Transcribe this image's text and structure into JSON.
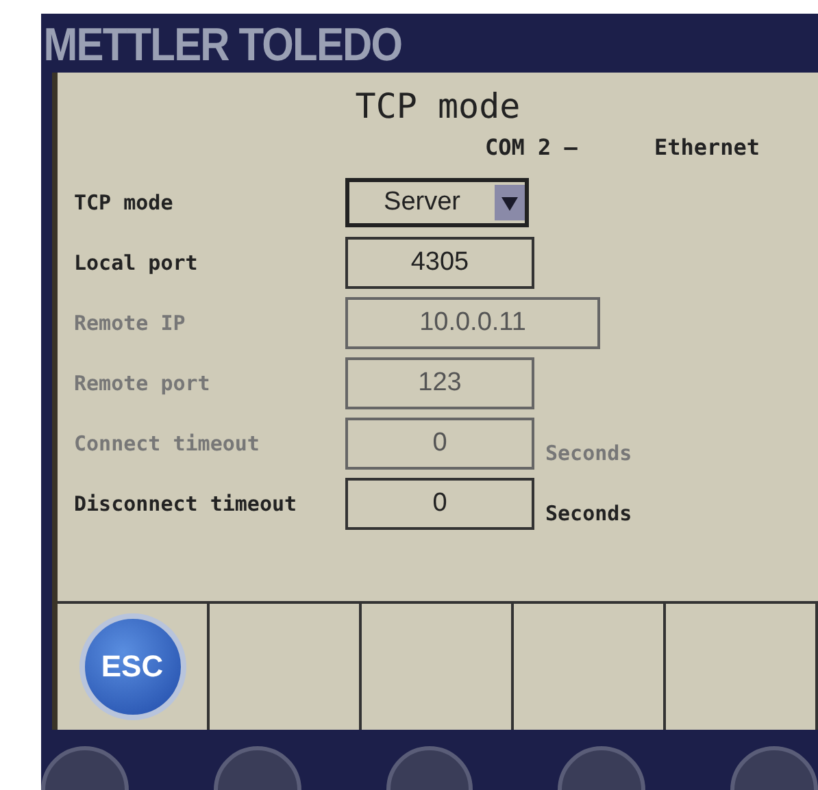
{
  "brand": {
    "logo": "METTLER TOLEDO"
  },
  "screen": {
    "title": "TCP mode",
    "subtitle_left": "COM 2  –",
    "subtitle_right": "Ethernet"
  },
  "fields": [
    {
      "kind": "dropdown",
      "label": "TCP mode",
      "value": "Server",
      "disabled": false,
      "wide": false
    },
    {
      "kind": "input",
      "label": "Local port",
      "value": "4305",
      "disabled": false,
      "wide": false
    },
    {
      "kind": "input",
      "label": "Remote IP",
      "value": "10.0.0.11",
      "disabled": true,
      "wide": true
    },
    {
      "kind": "input",
      "label": "Remote port",
      "value": "123",
      "disabled": true,
      "wide": false
    },
    {
      "kind": "input",
      "label": "Connect timeout",
      "value": "0",
      "disabled": true,
      "unit": "Seconds",
      "wide": false
    },
    {
      "kind": "input",
      "label": "Disconnect timeout",
      "value": "0",
      "disabled": false,
      "unit": "Seconds",
      "wide": false
    }
  ],
  "softkeys": [
    {
      "kind": "esc",
      "label": "ESC"
    },
    {
      "kind": "empty"
    },
    {
      "kind": "empty"
    },
    {
      "kind": "empty"
    },
    {
      "kind": "empty"
    }
  ]
}
